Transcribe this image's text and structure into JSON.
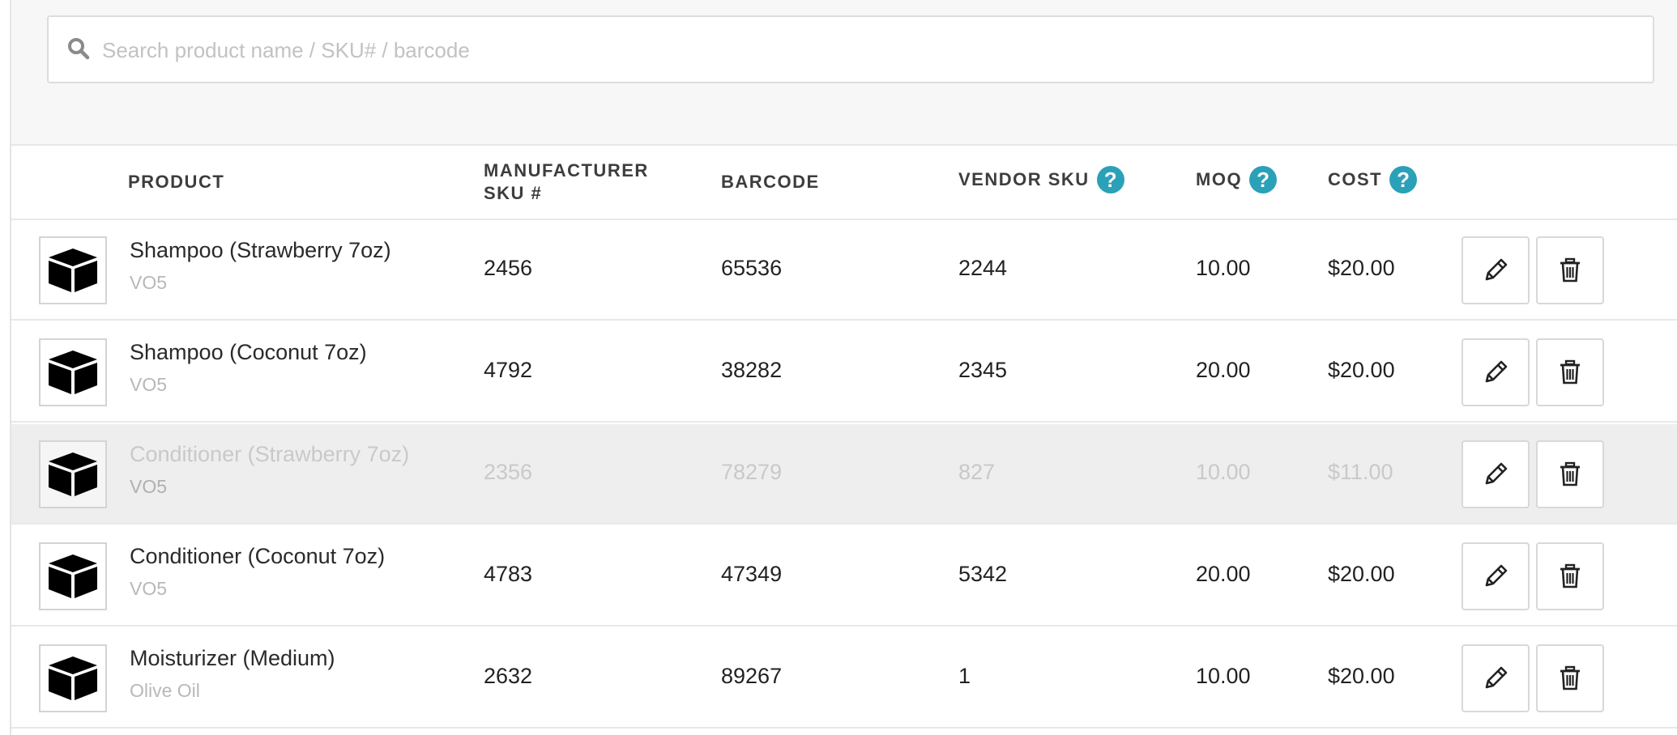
{
  "search": {
    "placeholder": "Search product name / SKU# / barcode",
    "value": ""
  },
  "columns": {
    "product": "PRODUCT",
    "manufacturer_sku_line1": "MANUFACTURER",
    "manufacturer_sku_line2": "SKU #",
    "barcode": "BARCODE",
    "vendor_sku": "VENDOR SKU",
    "moq": "MOQ",
    "cost": "COST",
    "help_glyph": "?"
  },
  "rows": [
    {
      "name": "Shampoo (Strawberry 7oz)",
      "brand": "VO5",
      "manufacturer_sku": "2456",
      "barcode": "65536",
      "vendor_sku": "2244",
      "moq": "10.00",
      "cost": "$20.00",
      "disabled": false
    },
    {
      "name": "Shampoo (Coconut 7oz)",
      "brand": "VO5",
      "manufacturer_sku": "4792",
      "barcode": "38282",
      "vendor_sku": "2345",
      "moq": "20.00",
      "cost": "$20.00",
      "disabled": false
    },
    {
      "name": "Conditioner (Strawberry 7oz)",
      "brand": "VO5",
      "manufacturer_sku": "2356",
      "barcode": "78279",
      "vendor_sku": "827",
      "moq": "10.00",
      "cost": "$11.00",
      "disabled": true
    },
    {
      "name": "Conditioner (Coconut 7oz)",
      "brand": "VO5",
      "manufacturer_sku": "4783",
      "barcode": "47349",
      "vendor_sku": "5342",
      "moq": "20.00",
      "cost": "$20.00",
      "disabled": false
    },
    {
      "name": "Moisturizer (Medium)",
      "brand": "Olive Oil",
      "manufacturer_sku": "2632",
      "barcode": "89267",
      "vendor_sku": "1",
      "moq": "10.00",
      "cost": "$20.00",
      "disabled": false
    }
  ],
  "icons": {
    "search": "search-icon",
    "product_thumbnail": "box-icon",
    "edit": "pencil-icon",
    "delete": "trash-icon",
    "help": "help-icon"
  },
  "colors": {
    "help_accent": "#2aa1b8",
    "disabled_row_bg": "#eeeeee",
    "disabled_text": "#c9c9c9"
  }
}
